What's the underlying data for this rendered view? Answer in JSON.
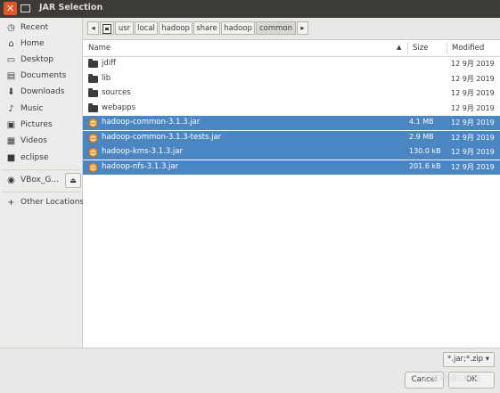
{
  "window": {
    "title": "JAR Selection",
    "close_glyph": "✕"
  },
  "sidebar": {
    "items": [
      {
        "label": "Recent",
        "icon": "clock-icon",
        "glyph": "◷"
      },
      {
        "label": "Home",
        "icon": "home-icon",
        "glyph": "⌂"
      },
      {
        "label": "Desktop",
        "icon": "desktop-icon",
        "glyph": "▭"
      },
      {
        "label": "Documents",
        "icon": "documents-icon",
        "glyph": "▤"
      },
      {
        "label": "Downloads",
        "icon": "download-icon",
        "glyph": "⬇"
      },
      {
        "label": "Music",
        "icon": "music-icon",
        "glyph": "♪"
      },
      {
        "label": "Pictures",
        "icon": "pictures-icon",
        "glyph": "▣"
      },
      {
        "label": "Videos",
        "icon": "videos-icon",
        "glyph": "▦"
      },
      {
        "label": "eclipse",
        "icon": "folder-icon",
        "glyph": "■"
      },
      {
        "label": "VBox_G...",
        "icon": "disc-icon",
        "glyph": "◉"
      }
    ],
    "eject_glyph": "⏏",
    "other_locations": {
      "label": "Other Locations",
      "glyph": "+"
    }
  },
  "pathbar": {
    "back_glyph": "◂",
    "forward_glyph": "▸",
    "segments": [
      "usr",
      "local",
      "hadoop",
      "share",
      "hadoop",
      "common"
    ],
    "active_index": 5
  },
  "filelist": {
    "columns": {
      "name": "Name",
      "size": "Size",
      "modified": "Modified"
    },
    "sort_glyph": "▲",
    "rows": [
      {
        "name": "jdiff",
        "size": "",
        "modified": "12 9月 2019",
        "type": "folder",
        "selected": false
      },
      {
        "name": "lib",
        "size": "",
        "modified": "12 9月 2019",
        "type": "folder",
        "selected": false
      },
      {
        "name": "sources",
        "size": "",
        "modified": "12 9月 2019",
        "type": "folder",
        "selected": false
      },
      {
        "name": "webapps",
        "size": "",
        "modified": "12 9月 2019",
        "type": "folder",
        "selected": false
      },
      {
        "name": "hadoop-common-3.1.3.jar",
        "size": "4.1 MB",
        "modified": "12 9月 2019",
        "type": "jar",
        "selected": true
      },
      {
        "name": "hadoop-common-3.1.3-tests.jar",
        "size": "2.9 MB",
        "modified": "12 9月 2019",
        "type": "jar",
        "selected": true
      },
      {
        "name": "hadoop-kms-3.1.3.jar",
        "size": "130.0 kB",
        "modified": "12 9月 2019",
        "type": "jar",
        "selected": true
      },
      {
        "name": "hadoop-nfs-3.1.3.jar",
        "size": "201.6 kB",
        "modified": "12 9月 2019",
        "type": "jar",
        "selected": true
      }
    ]
  },
  "footer": {
    "filter": "*.jar;*.zip ▾",
    "cancel_label": "Cancel",
    "ok_label": "OK"
  },
  "watermark": "CSDN @Z9hiiJ",
  "colors": {
    "titlebar": "#3c3b37",
    "close": "#e95420",
    "selection": "#4a86c1",
    "sidebar": "#edeceb"
  }
}
